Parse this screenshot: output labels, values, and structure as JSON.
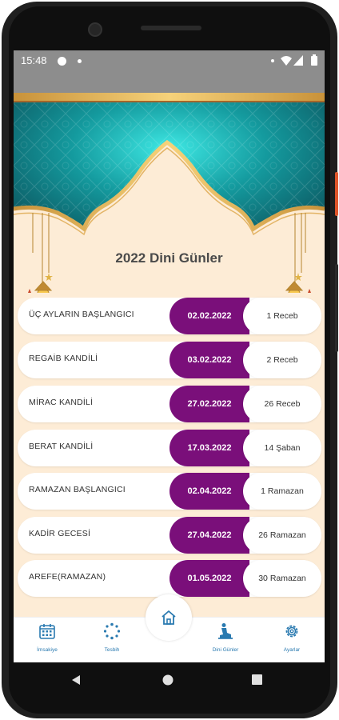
{
  "status_bar": {
    "time": "15:48"
  },
  "page_title": "2022 Dini Günler",
  "rows": [
    {
      "name": "ÜÇ AYLARIN BAŞLANGICI",
      "date": "02.02.2022",
      "hijri": "1 Receb"
    },
    {
      "name": "REGAİB KANDİLİ",
      "date": "03.02.2022",
      "hijri": "2 Receb"
    },
    {
      "name": "MİRAC KANDİLİ",
      "date": "27.02.2022",
      "hijri": "26 Receb"
    },
    {
      "name": "BERAT KANDİLİ",
      "date": "17.03.2022",
      "hijri": "14 Şaban"
    },
    {
      "name": "RAMAZAN BAŞLANGICI",
      "date": "02.04.2022",
      "hijri": "1 Ramazan"
    },
    {
      "name": "KADİR GECESİ",
      "date": "27.04.2022",
      "hijri": "26 Ramazan"
    },
    {
      "name": "AREFE(RAMAZAN)",
      "date": "01.05.2022",
      "hijri": "30 Ramazan"
    }
  ],
  "nav": {
    "imsakiye": "İmsakiye",
    "tesbih": "Tesbih",
    "dini_gunler": "Dini Günler",
    "ayarlar": "Ayarlar"
  },
  "colors": {
    "accent": "#7a0f7a",
    "nav_blue": "#2a7ab0",
    "background": "#fdecd6"
  },
  "icons": [
    "calendar-icon",
    "tesbih-icon",
    "home-icon",
    "praying-person-icon",
    "gear-icon",
    "back-icon",
    "home-circle-icon",
    "recents-icon"
  ]
}
